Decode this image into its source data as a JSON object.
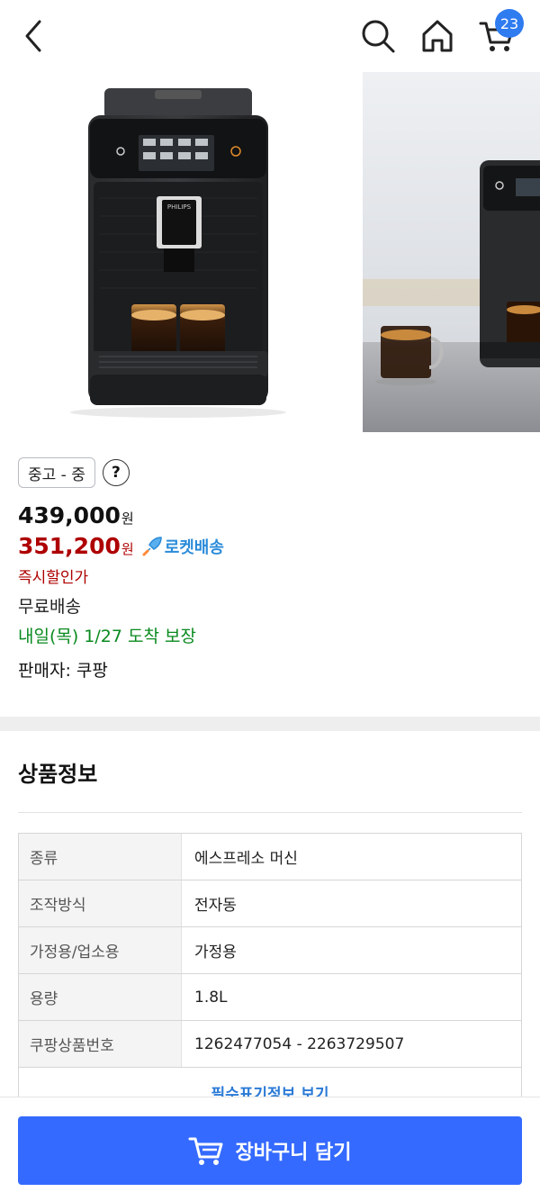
{
  "header": {
    "cart_count": "23"
  },
  "product": {
    "condition_label": "중고 - 중",
    "help_label": "?",
    "original_price": "439,000",
    "sale_price": "351,200",
    "currency": "원",
    "rocket_label": "로켓배송",
    "instant_discount": "즉시할인가",
    "shipping": "무료배송",
    "arrival": "내일(목) 1/27 도착 보장",
    "seller": "판매자: 쿠팡"
  },
  "details": {
    "title": "상품정보",
    "rows": [
      {
        "key": "종류",
        "value": "에스프레소 머신"
      },
      {
        "key": "조작방식",
        "value": "전자동"
      },
      {
        "key": "가정용/업소용",
        "value": "가정용"
      },
      {
        "key": "용량",
        "value": "1.8L"
      },
      {
        "key": "쿠팡상품번호",
        "value": "1262477054 - 2263729507"
      }
    ],
    "more_link": "필수표기정보 보기"
  },
  "bottom": {
    "add_to_cart": "장바구니 담기"
  },
  "colors": {
    "accent": "#346aff",
    "sale": "#ae0000",
    "arrival": "#0a8a1f",
    "rocket": "#2a8bd9",
    "badge": "#2f7bf0"
  },
  "icons": {
    "back": "chevron-left-icon",
    "search": "search-icon",
    "home": "home-icon",
    "cart": "cart-icon",
    "rocket": "rocket-icon"
  }
}
